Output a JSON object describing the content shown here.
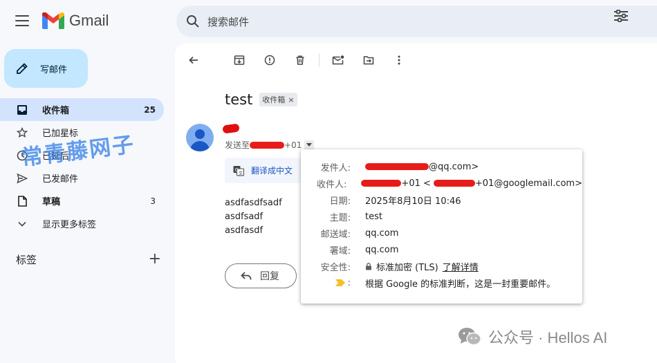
{
  "app": {
    "name": "Gmail"
  },
  "search": {
    "placeholder": "搜索邮件"
  },
  "compose": {
    "label": "写邮件"
  },
  "sidebar": {
    "items": [
      {
        "label": "收件箱",
        "count": "25",
        "icon": "inbox-icon"
      },
      {
        "label": "已加星标",
        "count": "",
        "icon": "star-icon"
      },
      {
        "label": "已延后",
        "count": "",
        "icon": "clock-icon"
      },
      {
        "label": "已发邮件",
        "count": "",
        "icon": "send-icon"
      },
      {
        "label": "草稿",
        "count": "3",
        "icon": "draft-icon"
      },
      {
        "label": "显示更多标签",
        "count": "",
        "icon": "chevron-down-icon"
      }
    ],
    "labels_title": "标签"
  },
  "email": {
    "subject": "test",
    "tag": "收件箱",
    "to_prefix": "发送至",
    "to_suffix": "+01",
    "translate": "翻译成中文",
    "body": [
      "asdfasdfsadf",
      "asdfsadf",
      "asdfasdf"
    ],
    "reply": "回复"
  },
  "details": {
    "from_label": "发件人:",
    "from_value": "@qq.com>",
    "to_label": "收件人:",
    "to_value_a": "+01 <",
    "to_value_b": "+01@googlemail.com>",
    "date_label": "日期:",
    "date_value": "2025年8月10日 10:46",
    "subject_label": "主题:",
    "subject_value": "test",
    "mailed_by_label": "邮送域:",
    "mailed_by_value": "qq.com",
    "signed_by_label": "署域:",
    "signed_by_value": "qq.com",
    "security_label": "安全性:",
    "security_value": "标准加密 (TLS)",
    "security_link": "了解详情",
    "importance_label": ":",
    "importance_value": "根据 Google 的标准判断，这是一封重要邮件。"
  },
  "watermark": {
    "overlay": "常青藤网子",
    "footer": "公众号 · Hellos AI"
  },
  "colors": {
    "accent": "#0b57d0",
    "compose_bg": "#c2e7ff",
    "active_nav": "#d3e3fd",
    "redaction": "#e81b1b"
  }
}
